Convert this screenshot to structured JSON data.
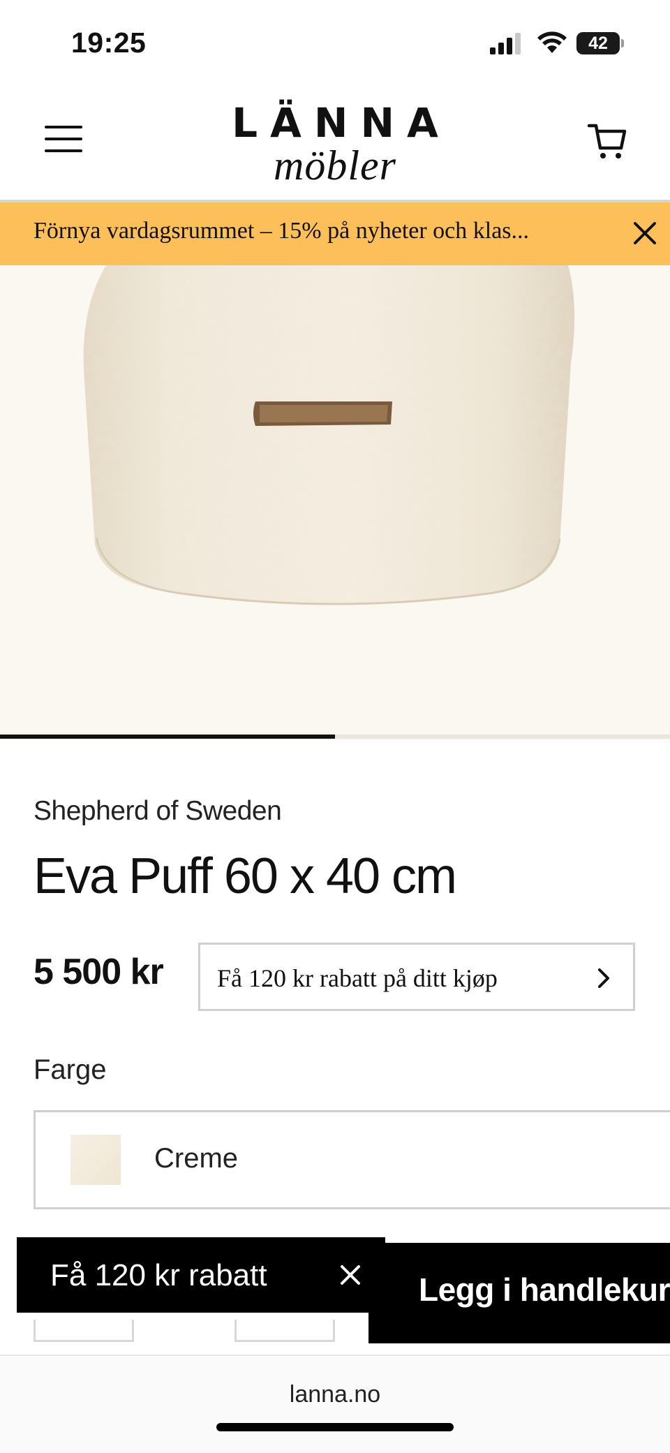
{
  "status_bar": {
    "time": "19:25",
    "battery": "42"
  },
  "header": {
    "logo_top": "LÄNNA",
    "logo_bottom": "möbler",
    "menu_icon": "hamburger-menu-icon",
    "cart_icon": "shopping-cart-icon"
  },
  "promo": {
    "text": "Förnya vardagsrummet – 15% på nyheter och klas...",
    "close_icon": "close-icon"
  },
  "gallery": {
    "progress": 0.5
  },
  "product": {
    "brand": "Shepherd of Sweden",
    "title": "Eva Puff 60 x 40 cm",
    "price": "5 500 kr",
    "discount_offer": "Få 120 kr rabatt på ditt kjøp",
    "color_label": "Farge",
    "color_value": "Creme"
  },
  "sticky": {
    "toast_text": "Få 120 kr rabatt",
    "add_to_cart": "Legg i handlekurv"
  },
  "browser": {
    "url": "lanna.no"
  },
  "colors": {
    "promo": "#fdbf5a",
    "cta": "#000000"
  }
}
